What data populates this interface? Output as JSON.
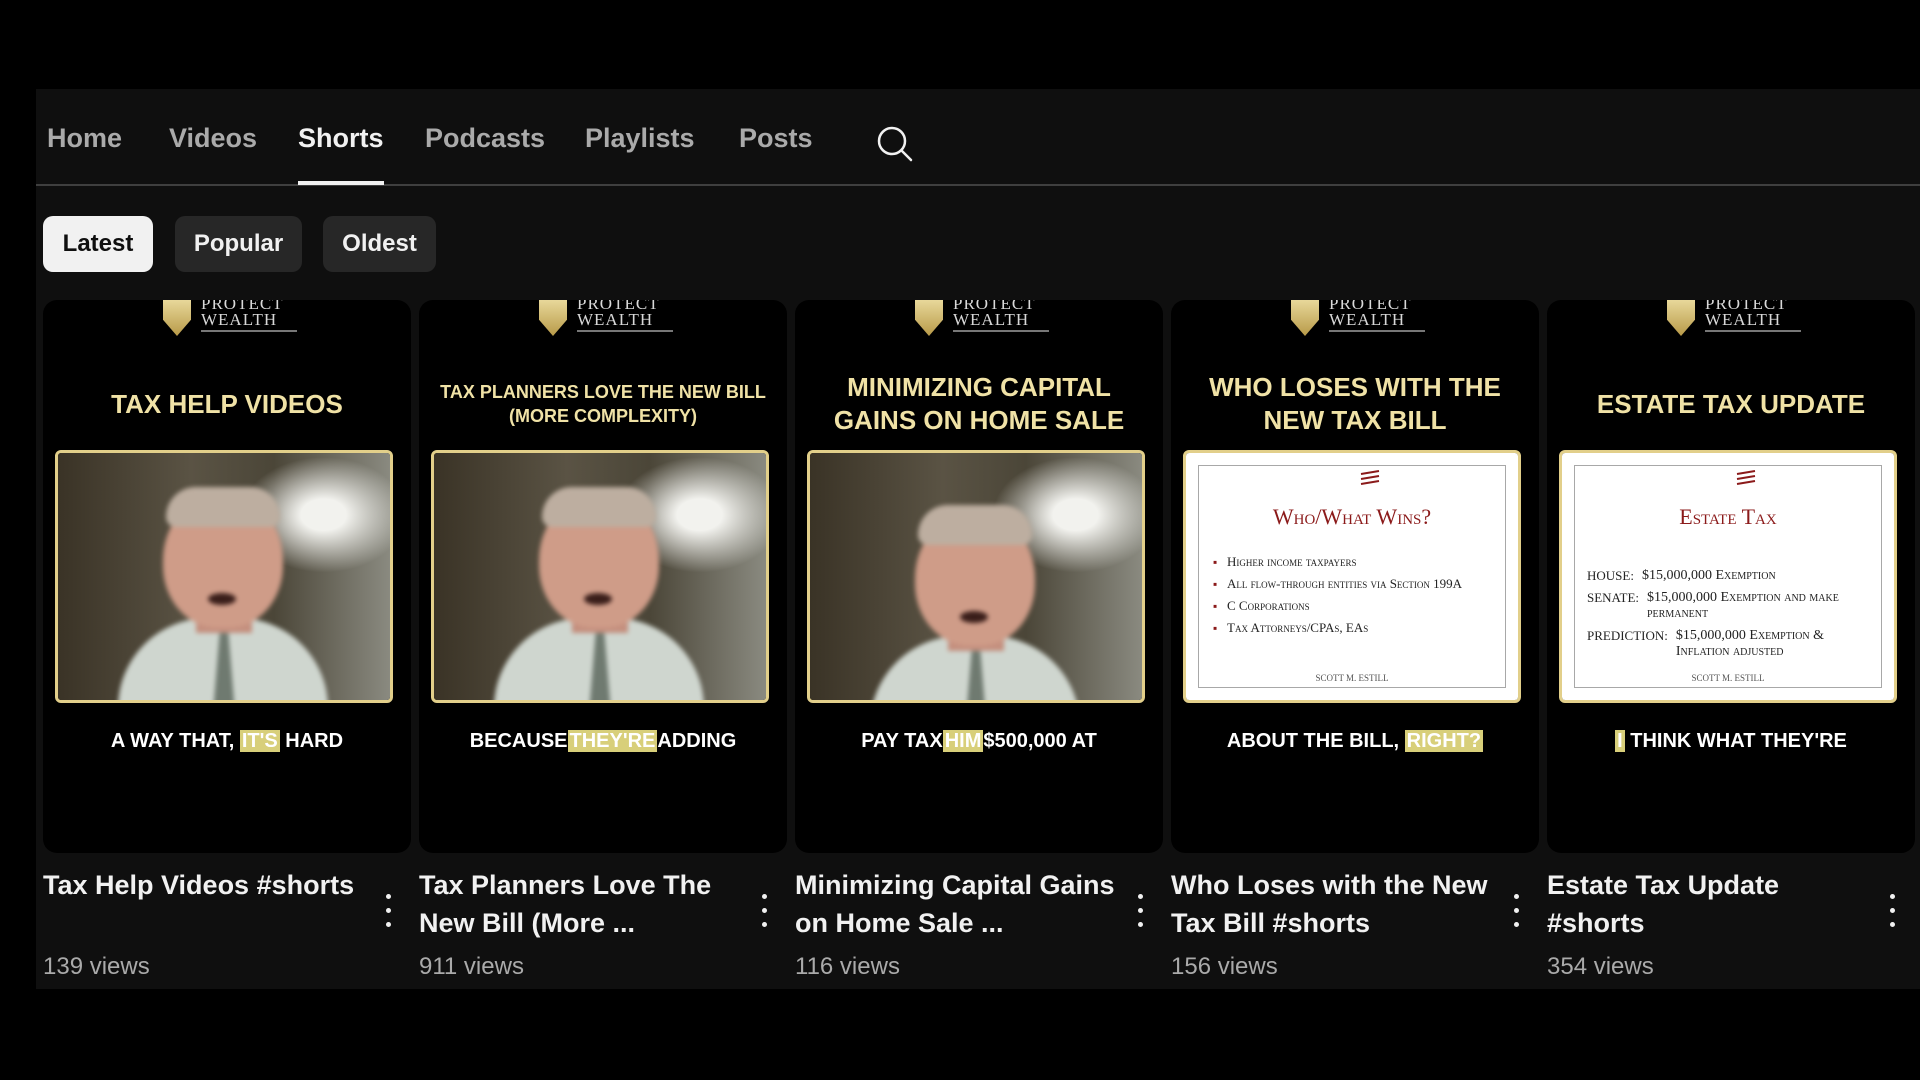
{
  "tabs": [
    {
      "label": "Home",
      "active": false
    },
    {
      "label": "Videos",
      "active": false
    },
    {
      "label": "Shorts",
      "active": true
    },
    {
      "label": "Podcasts",
      "active": false
    },
    {
      "label": "Playlists",
      "active": false
    },
    {
      "label": "Posts",
      "active": false
    }
  ],
  "search_icon": "search-icon",
  "filters": [
    {
      "label": "Latest",
      "active": true
    },
    {
      "label": "Popular",
      "active": false
    },
    {
      "label": "Oldest",
      "active": false
    }
  ],
  "brand": {
    "logo_text_1": "PROTECT",
    "logo_text_2": "WEALTH"
  },
  "colors": {
    "headline": "#f0e2a6",
    "highlight": "#d8cf7a",
    "slide_title": "#8b1a1a"
  },
  "shorts": [
    {
      "headline": "TAX HELP VIDEOS",
      "caption": {
        "before": "A WAY THAT,",
        "highlight": "IT'S",
        "after": "HARD"
      },
      "title": "Tax Help Videos #shorts",
      "views": "139 views"
    },
    {
      "headline": "TAX PLANNERS LOVE THE NEW BILL (MORE COMPLEXITY)",
      "caption": {
        "before": "BECAUSE",
        "highlight": "THEY'RE",
        "after": "ADDING"
      },
      "title": "Tax Planners Love The New Bill (More ...",
      "views": "911 views"
    },
    {
      "headline": "MINIMIZING CAPITAL GAINS ON HOME SALE",
      "caption": {
        "before": "PAY TAX",
        "highlight": "HIM",
        "after": "$500,000 AT"
      },
      "title": "Minimizing Capital Gains on Home Sale ...",
      "views": "116 views"
    },
    {
      "headline": "WHO LOSES WITH THE NEW TAX BILL",
      "slide": {
        "title": "Who/What Wins?",
        "items": [
          "Higher income taxpayers",
          "All flow-through entities via Section 199A",
          "C Corporations",
          "Tax Attorneys/CPAs, EAs"
        ],
        "footer": "SCOTT M. ESTILL"
      },
      "caption": {
        "before": "ABOUT THE BILL,",
        "highlight": "RIGHT?",
        "after": ""
      },
      "title": "Who Loses with the New Tax Bill #shorts",
      "views": "156 views"
    },
    {
      "headline": "ESTATE TAX UPDATE",
      "slide": {
        "title": "Estate Tax",
        "rows": [
          {
            "k": "HOUSE:",
            "v": "$15,000,000 Exemption"
          },
          {
            "k": "SENATE:",
            "v": "$15,000,000 Exemption and make permanent"
          },
          {
            "k": "PREDICTION:",
            "v": "$15,000,000 Exemption & Inflation adjusted"
          }
        ],
        "footer": "SCOTT M. ESTILL"
      },
      "caption": {
        "before": "",
        "highlight": "I",
        "after": "THINK WHAT THEY'RE"
      },
      "title": "Estate Tax Update #shorts",
      "views": "354 views"
    }
  ]
}
